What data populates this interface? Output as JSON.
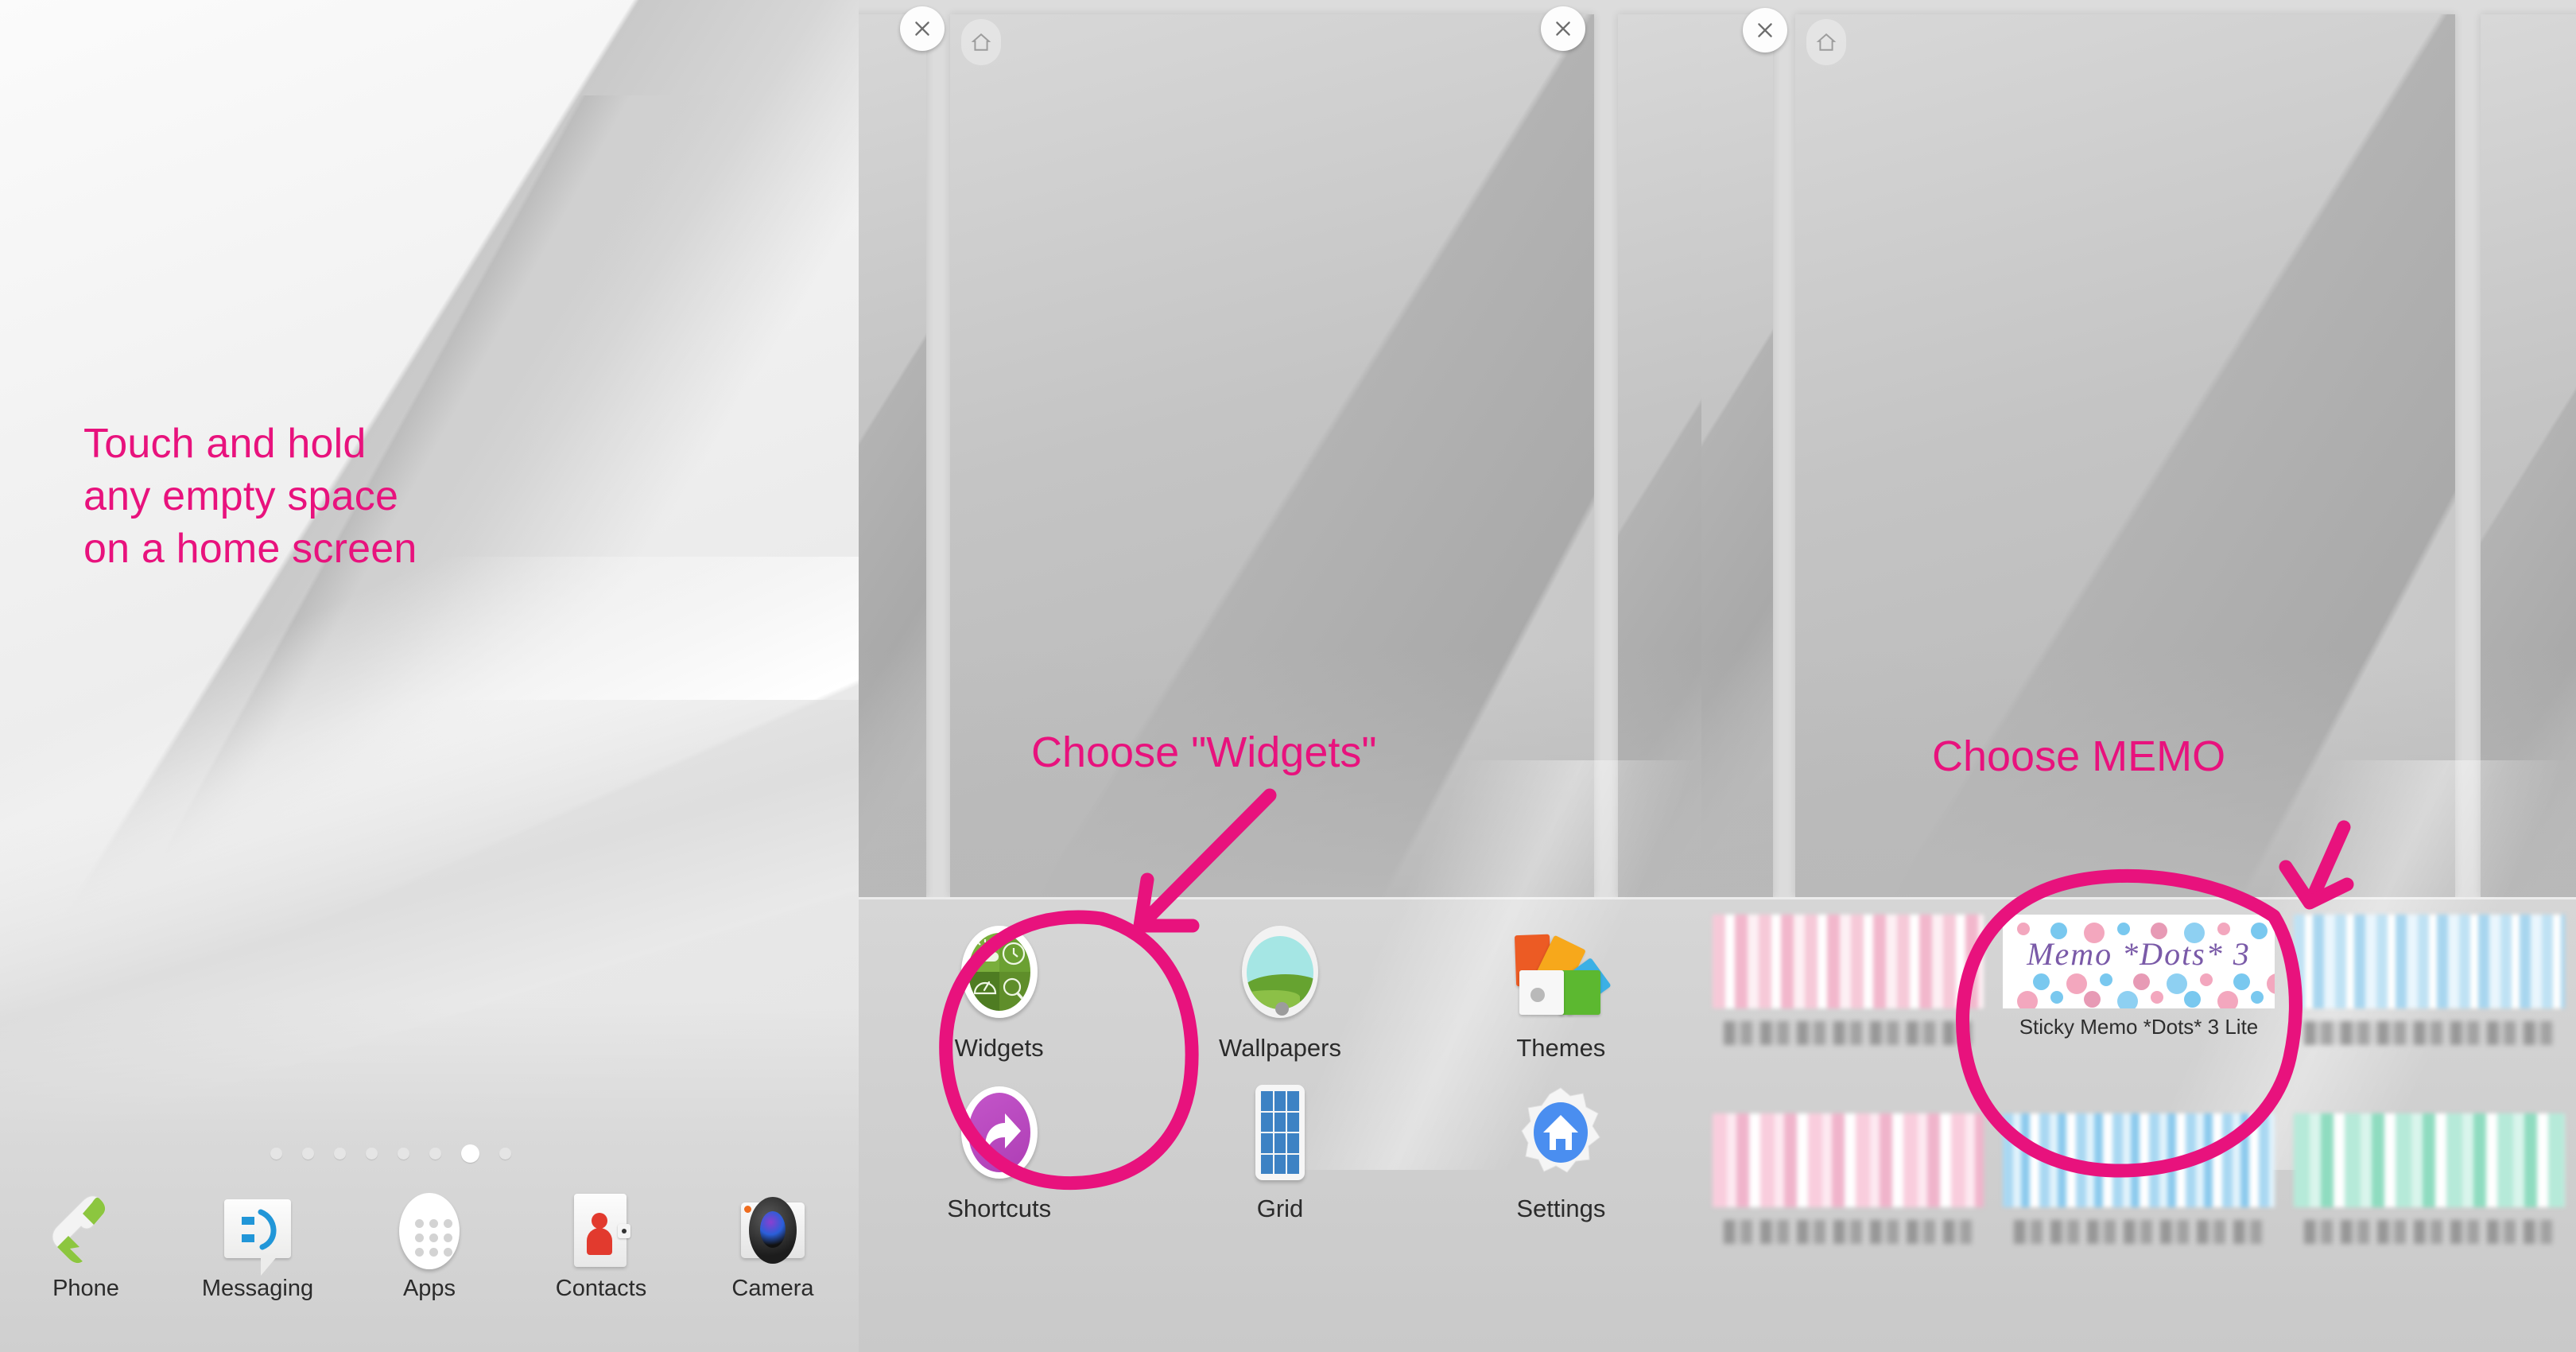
{
  "theme": {
    "marker_color": "#e8127d",
    "widget_accent_purple": "#7a5aa8"
  },
  "panel1": {
    "name": "home-screen",
    "hint": "Touch and hold\nany empty space\non a home screen",
    "page_indicator": {
      "total": 8,
      "active_index": 6
    },
    "dock": [
      {
        "label": "Phone",
        "icon": "phone-icon"
      },
      {
        "label": "Messaging",
        "icon": "messaging-icon"
      },
      {
        "label": "Apps",
        "icon": "apps-grid-icon"
      },
      {
        "label": "Contacts",
        "icon": "contacts-icon"
      },
      {
        "label": "Camera",
        "icon": "camera-icon"
      }
    ]
  },
  "panel2": {
    "name": "home-customize-sheet",
    "annotation": "Choose \"Widgets\"",
    "close_label": "✕",
    "home_badge_icon": "home-icon",
    "options": [
      {
        "label": "Widgets",
        "icon": "widgets-icon"
      },
      {
        "label": "Wallpapers",
        "icon": "wallpapers-icon"
      },
      {
        "label": "Themes",
        "icon": "themes-icon"
      },
      {
        "label": "Shortcuts",
        "icon": "shortcuts-icon"
      },
      {
        "label": "Grid",
        "icon": "grid-icon"
      },
      {
        "label": "Settings",
        "icon": "settings-gear-icon"
      }
    ]
  },
  "panel3": {
    "name": "widget-picker",
    "annotation": "Choose MEMO",
    "close_label": "✕",
    "home_badge_icon": "home-icon",
    "highlighted_widget": {
      "preview_title": "Memo *Dots* 3",
      "caption": "Sticky Memo *Dots* 3 Lite"
    },
    "widgets_row1": [
      {
        "caption_blurred": true,
        "swatch": "px-pink"
      },
      {
        "caption": "Sticky Memo *Dots* 3 Lite",
        "swatch": "memo"
      },
      {
        "caption_blurred": true,
        "swatch": "px-blue"
      }
    ],
    "widgets_row2": [
      {
        "caption_blurred": true,
        "swatch": "px-pink2"
      },
      {
        "caption_blurred": true,
        "swatch": "px-blue2"
      },
      {
        "caption_blurred": true,
        "swatch": "px-teal"
      }
    ]
  }
}
